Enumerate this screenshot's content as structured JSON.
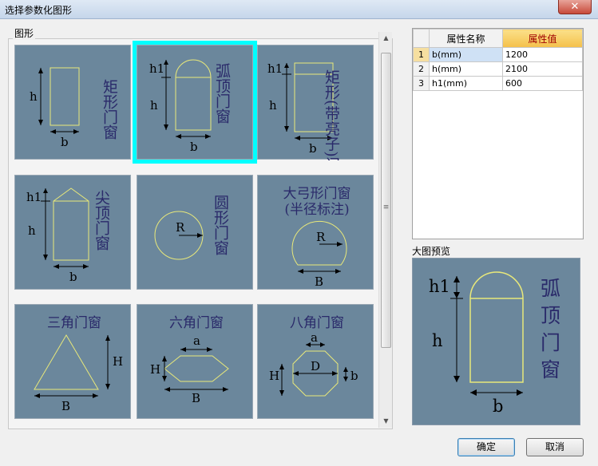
{
  "window": {
    "title": "选择参数化图形",
    "close_glyph": "✕"
  },
  "gallery": {
    "label": "图形",
    "items": [
      {
        "title": "矩形门窗",
        "labels": [
          "h",
          "b"
        ]
      },
      {
        "title": "弧顶门窗",
        "labels": [
          "h1",
          "h",
          "b"
        ],
        "selected": true
      },
      {
        "title": "矩形(带亮子)门窗",
        "labels": [
          "h1",
          "h",
          "b"
        ]
      },
      {
        "title": "尖顶门窗",
        "labels": [
          "h1",
          "h",
          "b"
        ]
      },
      {
        "title": "圆形门窗",
        "labels": [
          "R"
        ]
      },
      {
        "title": "大弓形门窗",
        "subtitle": "(半径标注)",
        "labels": [
          "R",
          "B"
        ]
      },
      {
        "title": "三角门窗",
        "labels": [
          "H",
          "B"
        ]
      },
      {
        "title": "六角门窗",
        "labels": [
          "a",
          "H",
          "B"
        ]
      },
      {
        "title": "八角门窗",
        "labels": [
          "a",
          "H",
          "D",
          "b"
        ]
      }
    ]
  },
  "properties": {
    "headers": [
      "属性名称",
      "属性值"
    ],
    "rows": [
      {
        "index": "1",
        "name": "b(mm)",
        "value": "1200"
      },
      {
        "index": "2",
        "name": "h(mm)",
        "value": "2100"
      },
      {
        "index": "3",
        "name": "h1(mm)",
        "value": "600"
      }
    ]
  },
  "preview": {
    "label": "大图预览",
    "title_chars": [
      "弧",
      "顶",
      "门",
      "窗"
    ],
    "labels": [
      "h1",
      "h",
      "b"
    ]
  },
  "buttons": {
    "ok": "确定",
    "cancel": "取消"
  },
  "colors": {
    "tile_bg": "#6b879c",
    "selected_border": "#00ffff",
    "shape_stroke": "#e8e87a",
    "title_text": "#2a2a6a"
  }
}
